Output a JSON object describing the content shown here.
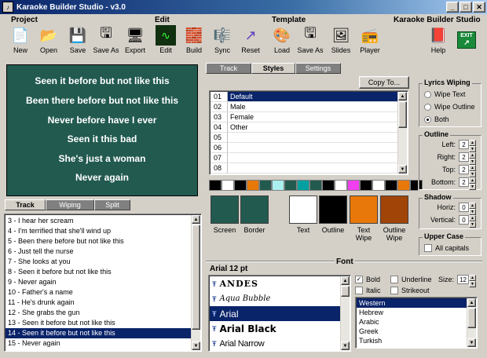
{
  "window": {
    "title": "Karaoke Builder Studio - v3.0",
    "icon": "app-icon"
  },
  "toolbar": {
    "groups": {
      "project": "Project",
      "edit": "Edit",
      "template": "Template",
      "brand": "Karaoke Builder Studio"
    },
    "buttons": {
      "new": "New",
      "open": "Open",
      "save": "Save",
      "save_as": "Save As",
      "export": "Export",
      "edit": "Edit",
      "build": "Build",
      "sync": "Sync",
      "reset": "Reset",
      "load": "Load",
      "tpl_save_as": "Save As",
      "slides": "Slides",
      "player": "Player",
      "help": "Help",
      "exit": "EXIT"
    }
  },
  "preview": {
    "lines": [
      "Seen it before but not like this",
      "Been there before but not like this",
      "Never before have I ever",
      "Seen it this bad",
      "She's just a woman",
      "Never again"
    ]
  },
  "left_tabs": {
    "track": "Track",
    "wiping": "Wiping",
    "split": "Split"
  },
  "track_list": [
    "3 - I hear her scream",
    "4 - I'm terrified that she'll wind up",
    "5 - Been there before but not like this",
    "6 - Just tell the nurse",
    "7 - She looks at you",
    "8 - Seen it before but not like this",
    "9 - Never again",
    "10 - Father's a name",
    "11 - He's drunk again",
    "12 - She grabs the gun",
    "13 - Seen it before but not like this",
    "14 - Seen it before but not like this",
    "15 - Never again"
  ],
  "track_selected_index": 11,
  "right_tabs": {
    "track": "Track",
    "styles": "Styles",
    "settings": "Settings"
  },
  "copy_to": "Copy To...",
  "styles": [
    {
      "num": "01",
      "name": "Default"
    },
    {
      "num": "02",
      "name": "Male"
    },
    {
      "num": "03",
      "name": "Female"
    },
    {
      "num": "04",
      "name": "Other"
    },
    {
      "num": "05",
      "name": ""
    },
    {
      "num": "06",
      "name": ""
    },
    {
      "num": "07",
      "name": ""
    },
    {
      "num": "08",
      "name": ""
    }
  ],
  "palette": [
    "#000000",
    "#ffffff",
    "#000000",
    "#e8780a",
    "#225a50",
    "#aaf0f0",
    "#225a50",
    "#00a0a0",
    "#225a50",
    "#000000",
    "#ffffff",
    "#f040f0",
    "#000000",
    "#ffffff",
    "#000000",
    "#e8780a",
    "#000000"
  ],
  "color_boxes": [
    {
      "label": "Screen",
      "color": "#225a50"
    },
    {
      "label": "Border",
      "color": "#225a50"
    },
    {
      "label": "Text",
      "color": "#ffffff"
    },
    {
      "label": "Outline",
      "color": "#000000"
    },
    {
      "label1": "Text",
      "label2": "Wipe",
      "color": "#e8780a"
    },
    {
      "label1": "Outline",
      "label2": "Wipe",
      "color": "#a04408"
    }
  ],
  "lyrics_wiping": {
    "title": "Lyrics Wiping",
    "wipe_text": "Wipe Text",
    "wipe_outline": "Wipe Outline",
    "both": "Both"
  },
  "outline": {
    "title": "Outline",
    "left_label": "Left:",
    "left": "2",
    "right_label": "Right:",
    "right": "2",
    "top_label": "Top:",
    "top": "2",
    "bottom_label": "Bottom:",
    "bottom": "2"
  },
  "shadow": {
    "title": "Shadow",
    "horiz_label": "Horiz:",
    "horiz": "0",
    "vertical_label": "Vertical:",
    "vertical": "0"
  },
  "upper_case": {
    "title": "Upper Case",
    "all_capitals": "All capitals"
  },
  "font": {
    "title": "Font",
    "current": "Arial 12 pt",
    "fonts": [
      "ANDES",
      "Aqua Bubble",
      "Arial",
      "Arial Black",
      "Arial Narrow"
    ],
    "selected": "Arial",
    "bold": "Bold",
    "italic": "Italic",
    "underline": "Underline",
    "strikeout": "Strikeout",
    "size_label": "Size:",
    "size": "12",
    "scripts": [
      "Western",
      "Hebrew",
      "Arabic",
      "Greek",
      "Turkish"
    ]
  }
}
